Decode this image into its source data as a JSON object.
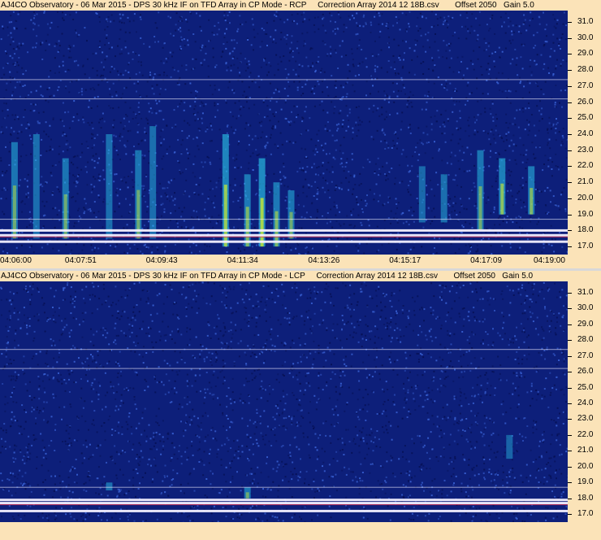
{
  "chart_data": [
    {
      "type": "heatmap",
      "title": "AJ4CO Observatory - 06 Mar 2015 - DPS 30 kHz IF on TFD Array in CP Mode - RCP     Correction Array 2014 12 18B.csv       Offset 2050   Gain 5.0",
      "polarization": "RCP",
      "x_ticks": [
        "04:06:00",
        "04:07:51",
        "04:09:43",
        "04:11:34",
        "04:13:26",
        "04:15:17",
        "04:17:09",
        "04:19:00"
      ],
      "y_ticks": [
        "31.0",
        "30.0",
        "29.0",
        "28.0",
        "27.0",
        "26.0",
        "25.0",
        "24.0",
        "23.0",
        "22.0",
        "21.0",
        "20.0",
        "19.0",
        "18.0",
        "17.0"
      ],
      "xlim": [
        "04:06:00",
        "04:19:00"
      ],
      "ylim_mhz": [
        16.5,
        31.7
      ],
      "interference_lines_mhz": [
        27.4,
        26.2,
        18.7,
        18.0,
        17.7,
        17.3
      ],
      "bursts": [
        {
          "t": "04:06:20",
          "f_low": 17.5,
          "f_high": 23.5,
          "intensity": 0.6
        },
        {
          "t": "04:06:50",
          "f_low": 17.5,
          "f_high": 24.0,
          "intensity": 0.5
        },
        {
          "t": "04:07:30",
          "f_low": 17.5,
          "f_high": 22.5,
          "intensity": 0.6
        },
        {
          "t": "04:08:30",
          "f_low": 17.5,
          "f_high": 24.0,
          "intensity": 0.5
        },
        {
          "t": "04:09:10",
          "f_low": 17.5,
          "f_high": 23.0,
          "intensity": 0.6
        },
        {
          "t": "04:09:30",
          "f_low": 17.5,
          "f_high": 24.5,
          "intensity": 0.5
        },
        {
          "t": "04:11:10",
          "f_low": 17.0,
          "f_high": 24.0,
          "intensity": 0.9
        },
        {
          "t": "04:11:40",
          "f_low": 17.0,
          "f_high": 21.5,
          "intensity": 0.7
        },
        {
          "t": "04:12:00",
          "f_low": 17.0,
          "f_high": 22.5,
          "intensity": 1.0
        },
        {
          "t": "04:12:20",
          "f_low": 17.0,
          "f_high": 21.0,
          "intensity": 0.7
        },
        {
          "t": "04:12:40",
          "f_low": 17.5,
          "f_high": 20.5,
          "intensity": 0.6
        },
        {
          "t": "04:15:40",
          "f_low": 18.5,
          "f_high": 22.0,
          "intensity": 0.4
        },
        {
          "t": "04:16:10",
          "f_low": 18.5,
          "f_high": 21.5,
          "intensity": 0.5
        },
        {
          "t": "04:17:00",
          "f_low": 18.0,
          "f_high": 23.0,
          "intensity": 0.6
        },
        {
          "t": "04:17:30",
          "f_low": 19.0,
          "f_high": 22.5,
          "intensity": 0.8
        },
        {
          "t": "04:18:10",
          "f_low": 19.0,
          "f_high": 22.0,
          "intensity": 0.7
        }
      ]
    },
    {
      "type": "heatmap",
      "title": "AJ4CO Observatory - 06 Mar 2015 - DPS 30 kHz IF on TFD Array in CP Mode - LCP     Correction Array 2014 12 18B.csv       Offset 2050   Gain 5.0",
      "polarization": "LCP",
      "x_ticks": [],
      "y_ticks": [
        "31.0",
        "30.0",
        "29.0",
        "28.0",
        "27.0",
        "26.0",
        "25.0",
        "24.0",
        "23.0",
        "22.0",
        "21.0",
        "20.0",
        "19.0",
        "18.0",
        "17.0"
      ],
      "xlim": [
        "04:06:00",
        "04:19:00"
      ],
      "ylim_mhz": [
        16.5,
        31.7
      ],
      "interference_lines_mhz": [
        27.4,
        26.2,
        18.7,
        17.9,
        17.7,
        17.2
      ],
      "bursts": [
        {
          "t": "04:08:30",
          "f_low": 18.5,
          "f_high": 19.0,
          "intensity": 0.5
        },
        {
          "t": "04:11:40",
          "f_low": 18.0,
          "f_high": 18.7,
          "intensity": 0.6
        },
        {
          "t": "04:17:40",
          "f_low": 20.5,
          "f_high": 22.0,
          "intensity": 0.3
        }
      ]
    }
  ],
  "colors": {
    "background": "#0d1f7a",
    "noise_dark": "#061054",
    "noise_light": "#3a63d6",
    "burst_low": "#28b8e0",
    "burst_high": "#c8e830",
    "interference": "#f4f0ff",
    "interference_red": "#e03050",
    "axis_bg": "#fbe3b8"
  }
}
